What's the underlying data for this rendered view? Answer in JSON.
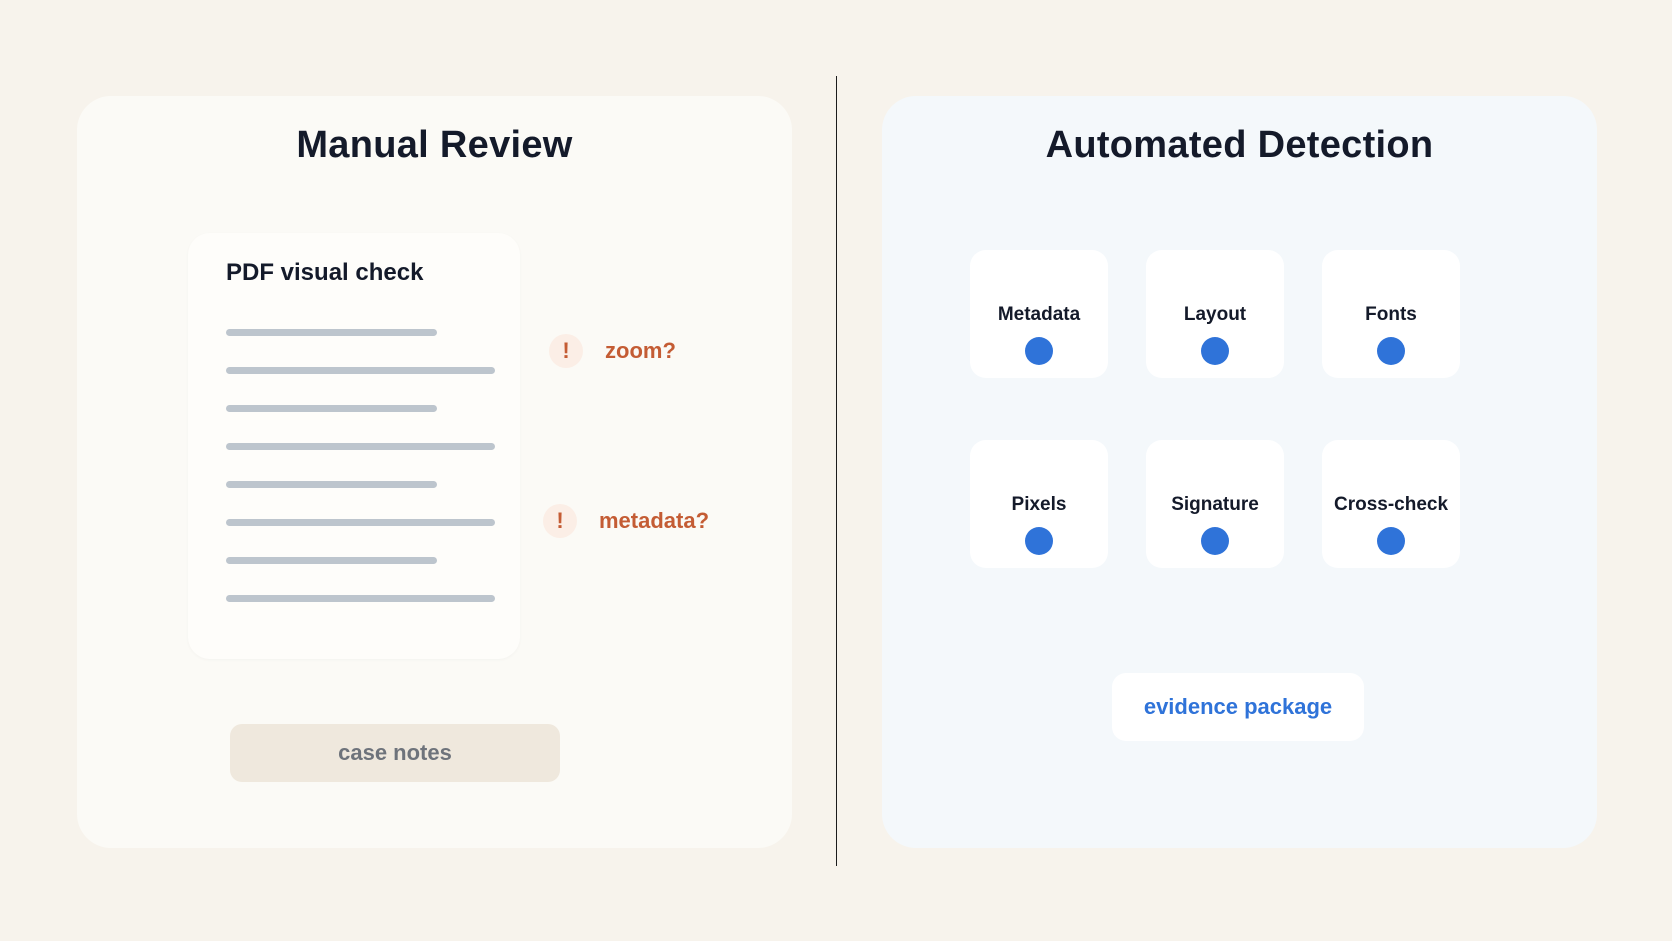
{
  "manual": {
    "title": "Manual Review",
    "doc_title": "PDF visual check",
    "flags": [
      {
        "icon": "!",
        "label": "zoom?"
      },
      {
        "icon": "!",
        "label": "metadata?"
      }
    ],
    "case_notes": "case notes"
  },
  "automated": {
    "title": "Automated Detection",
    "checks": [
      {
        "label": "Metadata"
      },
      {
        "label": "Layout"
      },
      {
        "label": "Fonts"
      },
      {
        "label": "Pixels"
      },
      {
        "label": "Signature"
      },
      {
        "label": "Cross-check"
      }
    ],
    "evidence": "evidence package"
  },
  "colors": {
    "background": "#f7f3ec",
    "manual_panel": "#fbfaf6",
    "automated_panel": "#f4f8fb",
    "warning": "#c45c34",
    "accent_blue": "#2f73d9",
    "heading": "#141a2a"
  }
}
